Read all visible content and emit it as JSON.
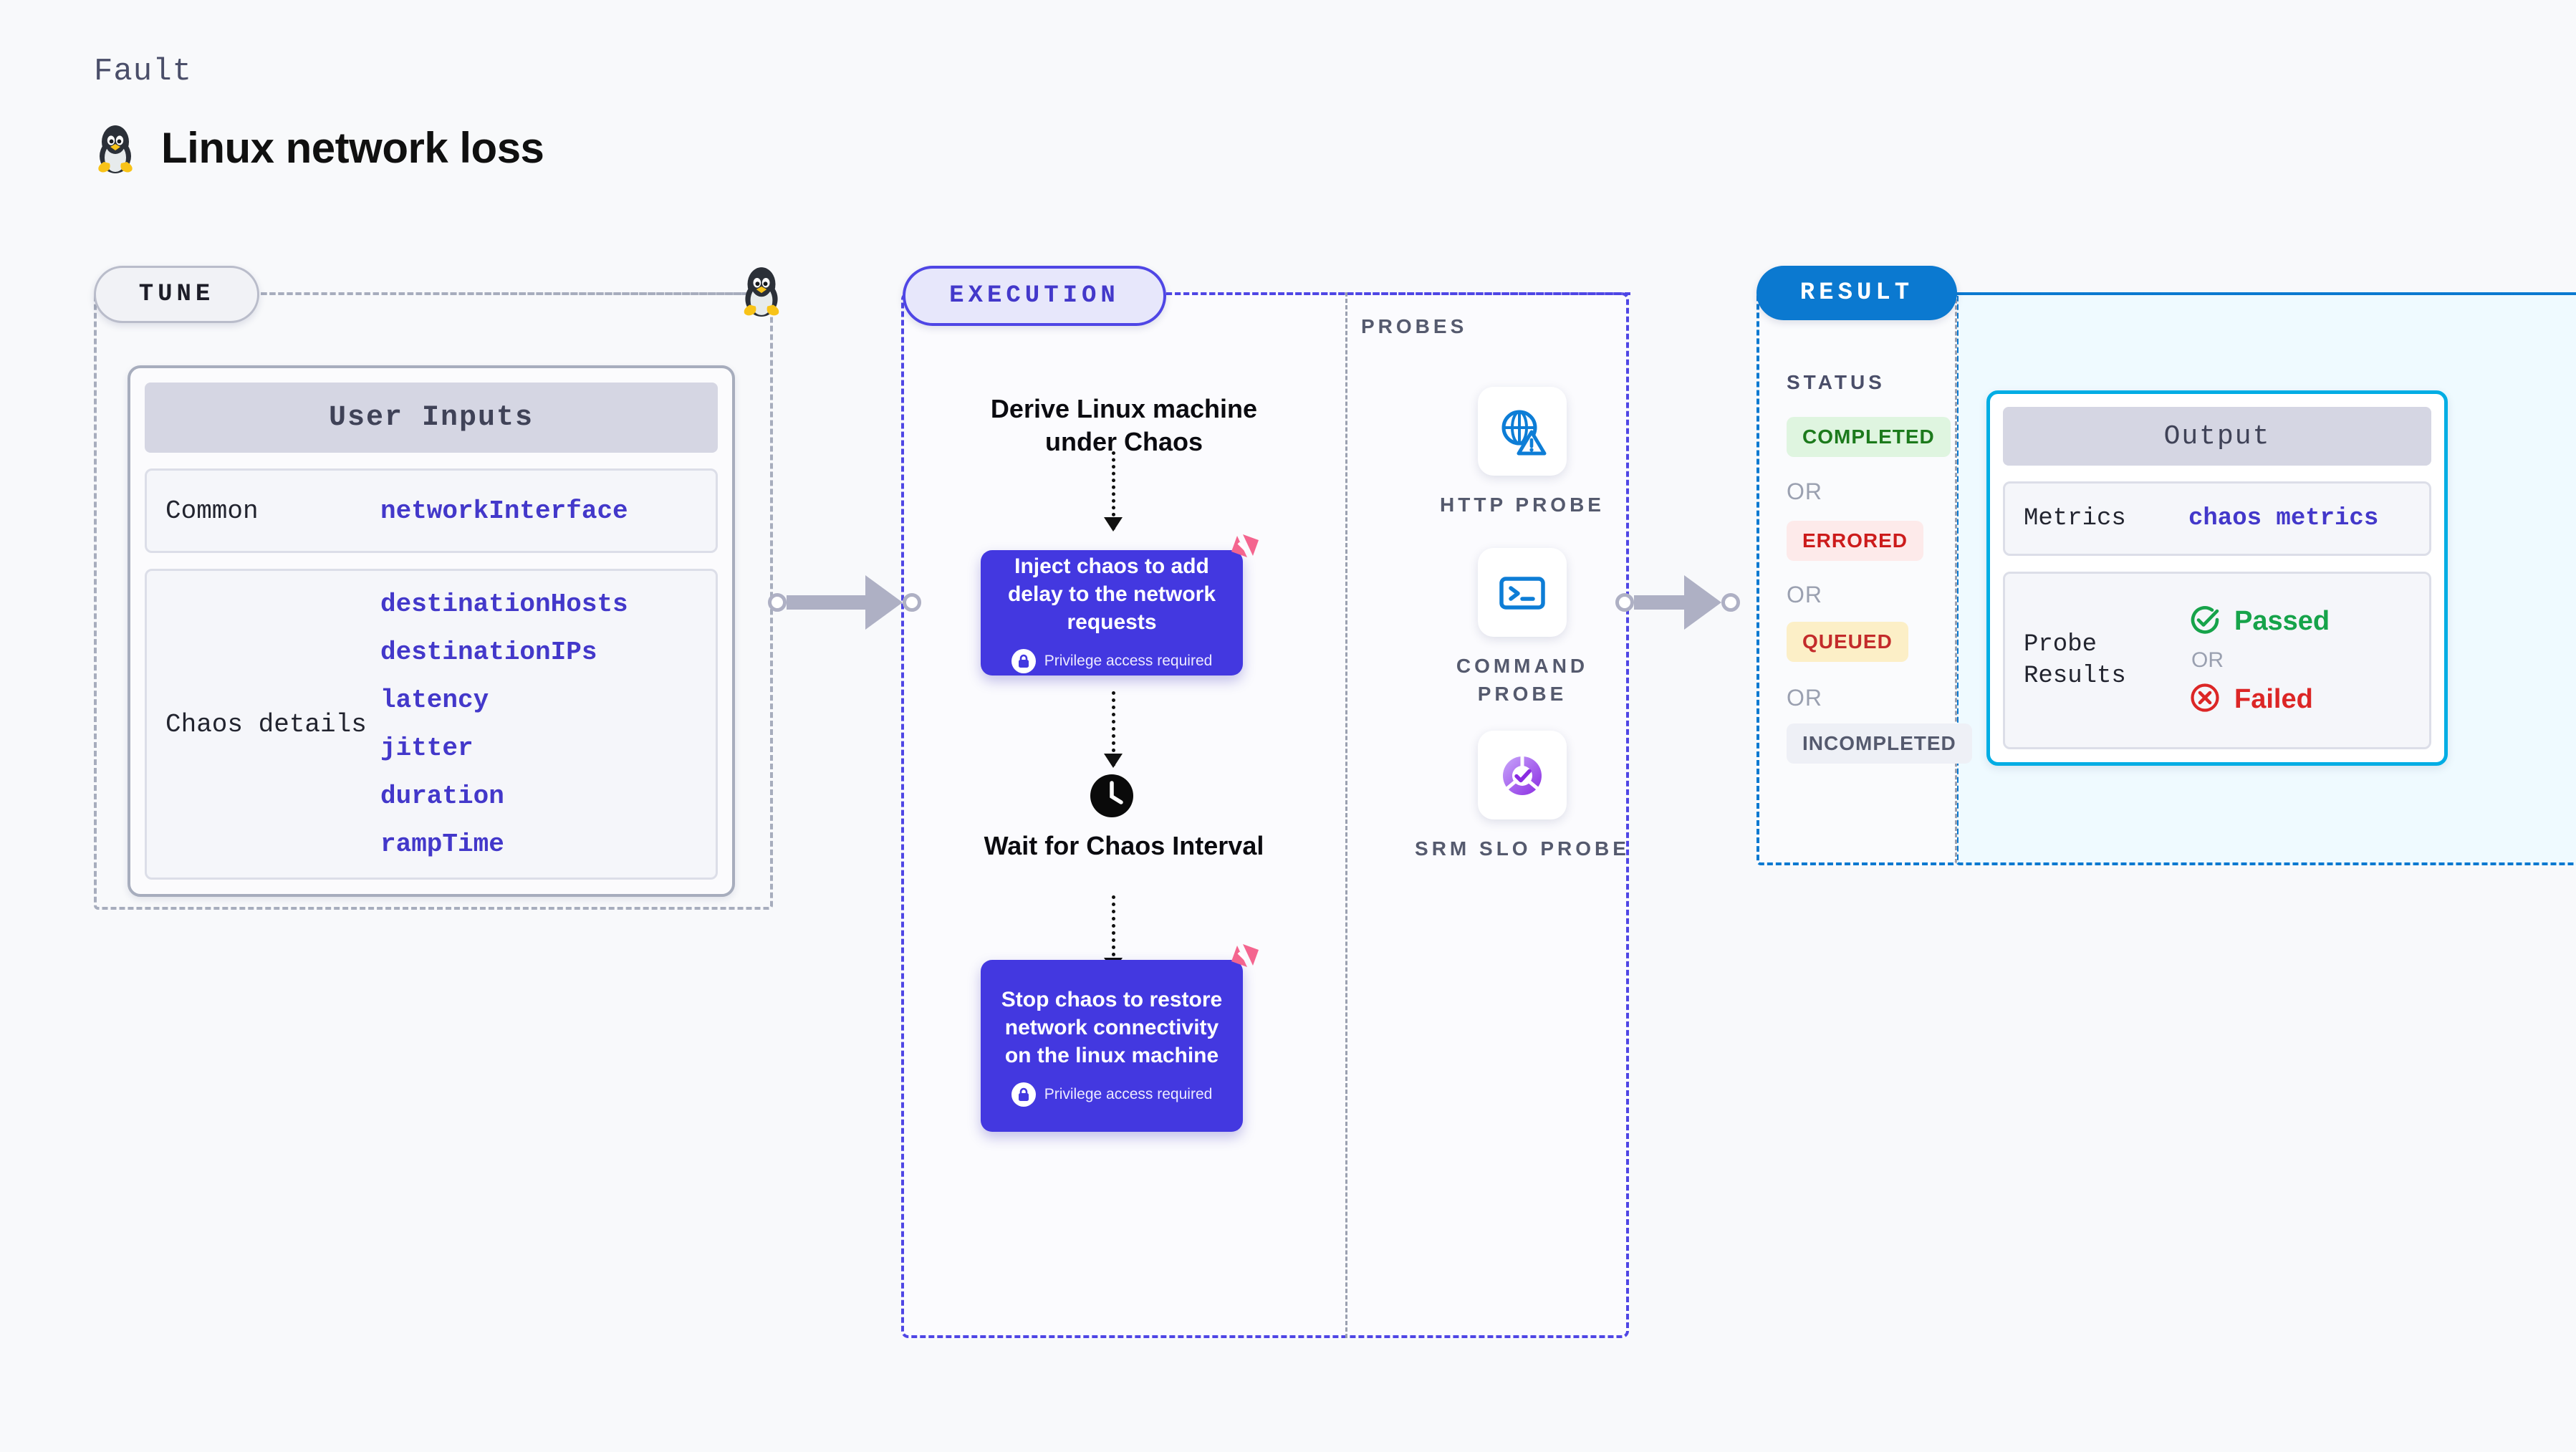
{
  "header": {
    "eyebrow": "Fault",
    "title": "Linux network loss",
    "icon": "linux-penguin-icon"
  },
  "phases": {
    "tune": "TUNE",
    "execution": "EXECUTION",
    "result": "RESULT"
  },
  "tune": {
    "card_title": "User Inputs",
    "rows": [
      {
        "label": "Common",
        "values": [
          "networkInterface"
        ]
      },
      {
        "label": "Chaos details",
        "values": [
          "destinationHosts",
          "destinationIPs",
          "latency",
          "jitter",
          "duration",
          "rampTime"
        ]
      }
    ]
  },
  "execution": {
    "step_derive": "Derive Linux machine under Chaos",
    "step_inject": "Inject chaos to add delay to the network requests",
    "step_wait": "Wait for Chaos Interval",
    "step_stop": "Stop chaos to restore network connectivity on the linux machine",
    "privilege_note": "Privilege access required",
    "clock_icon": "clock-icon",
    "harness_icon": "harness-logo-icon",
    "lock_icon": "lock-icon"
  },
  "probes": {
    "section_label": "PROBES",
    "items": [
      {
        "name": "HTTP PROBE",
        "icon": "globe-warning-icon"
      },
      {
        "name": "COMMAND PROBE",
        "icon": "terminal-icon"
      },
      {
        "name": "SRM SLO PROBE",
        "icon": "slo-donut-check-icon"
      }
    ]
  },
  "result": {
    "status_label": "STATUS",
    "or_text": "OR",
    "statuses": [
      {
        "label": "COMPLETED",
        "bg": "#dff5e0",
        "fg": "#1c7a1c"
      },
      {
        "label": "ERRORED",
        "bg": "#fdeaea",
        "fg": "#cc1b1b"
      },
      {
        "label": "QUEUED",
        "bg": "#fcefc7",
        "fg": "#c32b2b"
      },
      {
        "label": "INCOMPLETED",
        "bg": "#eef0f6",
        "fg": "#555a6e"
      }
    ],
    "output": {
      "card_title": "Output",
      "metrics_label": "Metrics",
      "metrics_value": "chaos metrics",
      "probe_results_label": "Probe Results",
      "passed": "Passed",
      "failed": "Failed",
      "or_text": "OR",
      "pass_icon": "check-circle-icon",
      "fail_icon": "x-circle-icon"
    }
  },
  "colors": {
    "accent_violet": "#4338e0",
    "accent_blue": "#0b79d0",
    "accent_cyan": "#00ade4",
    "pink_logo": "#f4658f",
    "gray_border": "#a7adbd",
    "canvas": "#f8f9fb"
  }
}
